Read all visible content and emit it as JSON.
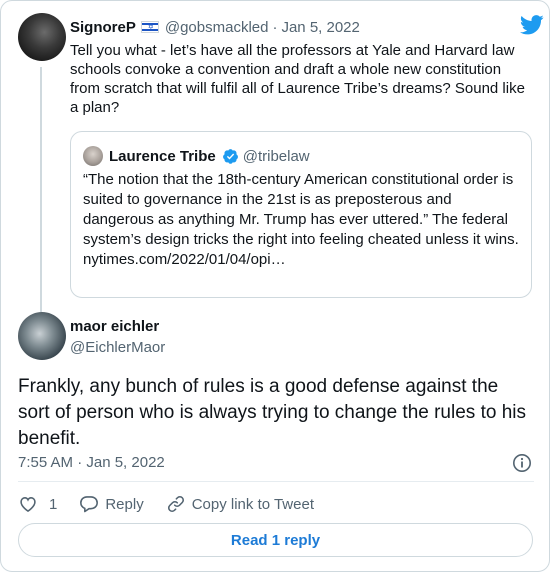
{
  "parent_tweet": {
    "author_name": "SignoreP",
    "handle": "@gobsmackled",
    "separator": "·",
    "date": "Jan 5, 2022",
    "text": "Tell you what - let’s have all the professors at Yale and Harvard law schools convoke a convention and draft a whole new constitution from scratch that will fulfil all of Laurence Tribe’s dreams? Sound like a plan?",
    "avatar_icon": "avatar-photo",
    "flag_icon": "israel-flag-icon"
  },
  "quoted_tweet": {
    "author_name": "Laurence Tribe",
    "handle": "@tribelaw",
    "text": "“The notion that the 18th-century American constitutional order is suited to governance in the 21st is as preposterous and dangerous as anything Mr. Trump has ever uttered.” The federal system’s design  tricks the right into feeling cheated unless it wins.",
    "link": "nytimes.com/2022/01/04/opi…"
  },
  "main_tweet": {
    "author_name": "maor eichler",
    "handle": "@EichlerMaor",
    "text": "Frankly, any bunch of rules is a good defense against the sort of person who is always trying to change the rules to his benefit.",
    "timestamp": "7:55 AM · Jan 5, 2022"
  },
  "actions": {
    "like_count": "1",
    "reply_label": "Reply",
    "copy_link_label": "Copy link to Tweet"
  },
  "read_replies_label": "Read 1 reply",
  "colors": {
    "twitter_blue": "#1d9bf0",
    "link_blue": "#1d7bd6",
    "secondary_text": "#536471",
    "border": "#cfd9de"
  }
}
